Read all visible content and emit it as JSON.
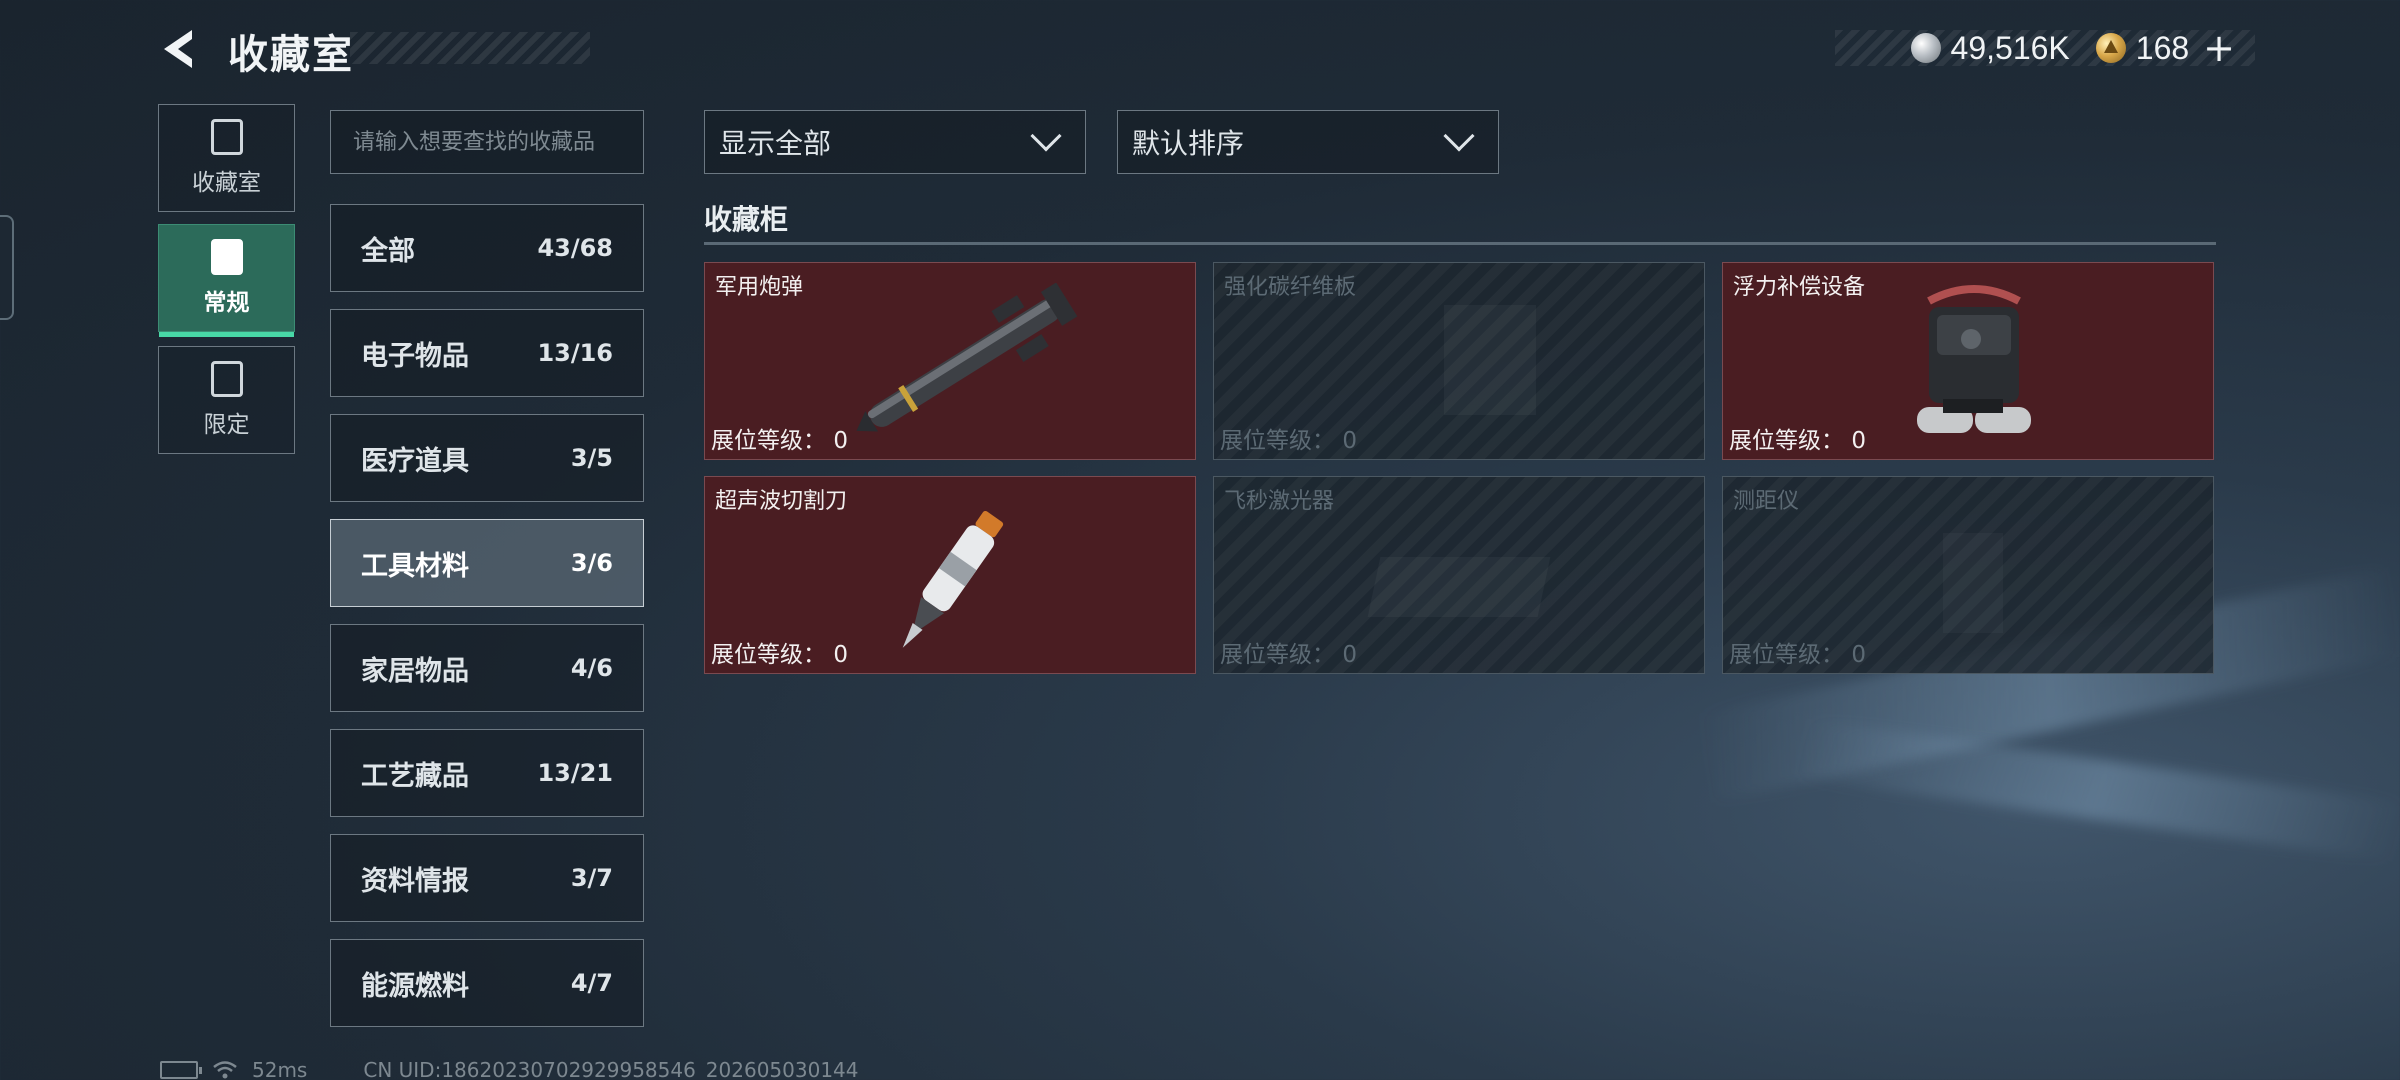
{
  "header": {
    "title": "收藏室",
    "currency": [
      {
        "icon": "silver-coin-icon",
        "value": "49,516K"
      },
      {
        "icon": "gold-coin-icon",
        "value": "168",
        "suffix": "+"
      }
    ]
  },
  "side_tabs": [
    {
      "label": "收藏室",
      "icon": "collection-icon",
      "active": false
    },
    {
      "label": "常规",
      "icon": "regular-icon",
      "active": true
    },
    {
      "label": "限定",
      "icon": "limited-icon",
      "active": false
    }
  ],
  "search": {
    "placeholder": "请输入想要查找的收藏品"
  },
  "categories": [
    {
      "name": "全部",
      "count": "43/68"
    },
    {
      "name": "电子物品",
      "count": "13/16"
    },
    {
      "name": "医疗道具",
      "count": "3/5"
    },
    {
      "name": "工具材料",
      "count": "3/6",
      "active": true
    },
    {
      "name": "家居物品",
      "count": "4/6"
    },
    {
      "name": "工艺藏品",
      "count": "13/21"
    },
    {
      "name": "资料情报",
      "count": "3/7"
    },
    {
      "name": "能源燃料",
      "count": "4/7"
    }
  ],
  "filters": {
    "display": "显示全部",
    "sort": "默认排序"
  },
  "section": {
    "title": "收藏柜"
  },
  "items": [
    {
      "name": "军用炮弹",
      "level_label": "展位等级：",
      "level": "0",
      "owned": true
    },
    {
      "name": "强化碳纤维板",
      "level_label": "展位等级：",
      "level": "0",
      "owned": false
    },
    {
      "name": "浮力补偿设备",
      "level_label": "展位等级：",
      "level": "0",
      "owned": true
    },
    {
      "name": "超声波切割刀",
      "level_label": "展位等级：",
      "level": "0",
      "owned": true
    },
    {
      "name": "飞秒激光器",
      "level_label": "展位等级：",
      "level": "0",
      "owned": false
    },
    {
      "name": "测距仪",
      "level_label": "展位等级：",
      "level": "0",
      "owned": false
    }
  ],
  "footer": {
    "ping": "52ms",
    "uid": "CN UID:18620230702929958546_202605030144"
  },
  "colors": {
    "owned_card": "#4a1d22",
    "active_tab": "#2c6b5a",
    "active_accent": "#48d8a6"
  }
}
